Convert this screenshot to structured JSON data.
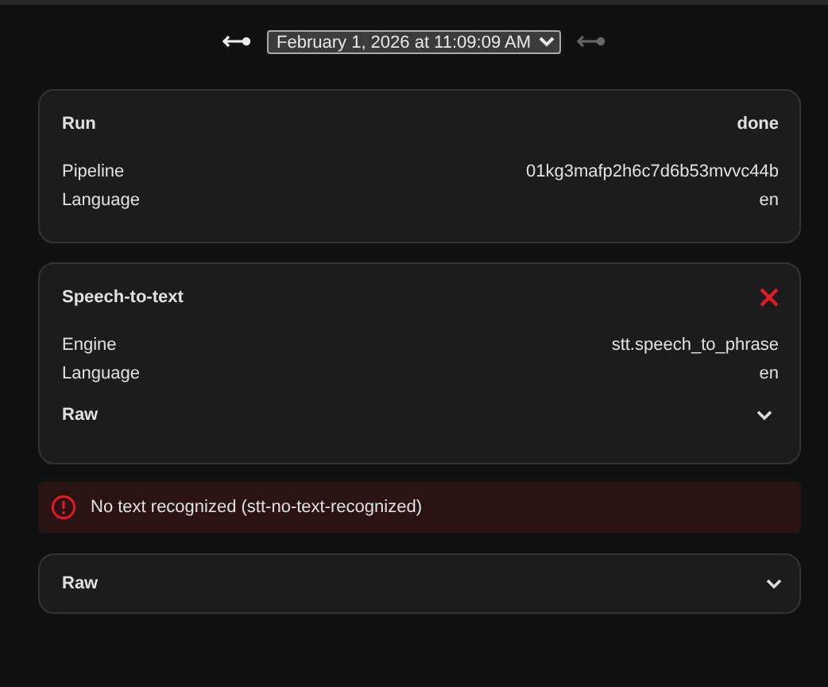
{
  "nav": {
    "prev": {
      "disabled": false
    },
    "run_select": {
      "value": "February 1, 2026 at 11:09:09 AM"
    },
    "next": {
      "disabled": true
    }
  },
  "cards": [
    {
      "title": "Run",
      "status": "done",
      "failed": false,
      "rows": [
        {
          "label": "Pipeline",
          "value": "01kg3mafp2h6c7d6b53mvvc44b"
        },
        {
          "label": "Language",
          "value": "en"
        }
      ]
    },
    {
      "title": "Speech-to-text",
      "failed": true,
      "rows": [
        {
          "label": "Engine",
          "value": "stt.speech_to_phrase"
        },
        {
          "label": "Language",
          "value": "en"
        }
      ],
      "raw": {
        "label": "Raw",
        "expanded": false
      }
    }
  ],
  "error": {
    "message": "No text recognized (stt-no-text-recognized)"
  },
  "raw": {
    "label": "Raw",
    "expanded": false
  }
}
